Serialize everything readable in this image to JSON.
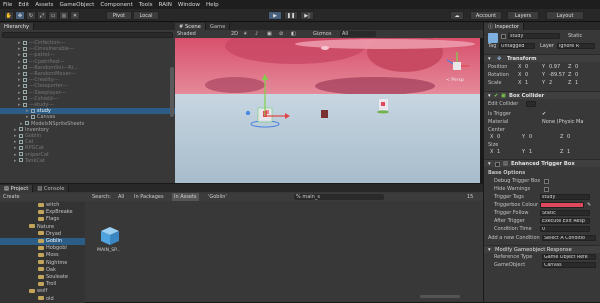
{
  "menubar": [
    "File",
    "Edit",
    "Assets",
    "GameObject",
    "Component",
    "Tools",
    "RAIN",
    "Window",
    "Help"
  ],
  "toolbar": {
    "pivot": "Pivot",
    "local": "Local",
    "account": "Account",
    "layers": "Layers",
    "layout": "Layout"
  },
  "hierarchy": {
    "tab": "Hierarchy",
    "rows": [
      {
        "label": "---Cinfection---",
        "style": "dim"
      },
      {
        "label": "---Cinvulnerable---",
        "style": "dim"
      },
      {
        "label": "---patrol---",
        "style": "dim"
      },
      {
        "label": "---Cpetrified---",
        "style": "dim"
      },
      {
        "label": "---RandomSni---Ri...",
        "style": "dim"
      },
      {
        "label": "---RandomMover---",
        "style": "dim"
      },
      {
        "label": "---Creality---",
        "style": "dim"
      },
      {
        "label": "---Cteleporter---",
        "style": "dim"
      },
      {
        "label": "---Sleeplayer---",
        "style": "dim"
      },
      {
        "label": "---Cshield---",
        "style": "dim"
      },
      {
        "label": "---study---",
        "style": "dim"
      },
      {
        "label": "study",
        "style": "sel"
      },
      {
        "label": "Canvas",
        "style": "norm"
      },
      {
        "label": "ModelsNSpriteSheets",
        "style": "norm"
      },
      {
        "label": "Inventory",
        "style": "norm"
      },
      {
        "label": "Goblin",
        "style": "dim"
      },
      {
        "label": "Cat",
        "style": "dim"
      },
      {
        "label": "RPGCat",
        "style": "dim"
      },
      {
        "label": "sniperCat",
        "style": "dim"
      },
      {
        "label": "TankCat",
        "style": "dim"
      }
    ]
  },
  "scene": {
    "tab_scene": "Scene",
    "tab_game": "Game",
    "shading": "Shaded",
    "mode": "2D",
    "gizmos": "Gizmos",
    "search": "All",
    "persp": "< Persp"
  },
  "inspector": {
    "tab": "Inspector",
    "object_name": "study",
    "static": "Static",
    "tag_label": "Tag",
    "tag": "Untagged",
    "layer_label": "Layer",
    "layer": "Ignore R",
    "transform": {
      "title": "Transform",
      "position": {
        "label": "Position",
        "x": "0",
        "y": "0.97",
        "z": "0"
      },
      "rotation": {
        "label": "Rotation",
        "x": "0",
        "y": "-89.57",
        "z": "0"
      },
      "scale": {
        "label": "Scale",
        "x": "1",
        "y": "2",
        "z": "1"
      }
    },
    "box_collider": {
      "title": "Box Collider",
      "edit_collider": "Edit Collider",
      "is_trigger": "Is Trigger",
      "material_label": "Material",
      "material": "None (Physic Ma",
      "center_label": "Center",
      "center": {
        "x": "0",
        "y": "0",
        "z": "0"
      },
      "size_label": "Size",
      "size": {
        "x": "1",
        "y": "1",
        "z": "1"
      }
    },
    "enhanced": {
      "title": "Enhanced Trigger Box",
      "base_options": "Base Options",
      "debug": "Debug Trigger Box",
      "hide_warnings": "Hide Warnings",
      "tags_label": "Trigger Tags",
      "tags": "study",
      "colour_label": "Triggerbox Colour",
      "follow_label": "Trigger Follow",
      "follow": "Static",
      "after_label": "After Trigger",
      "after": "Execute Exit Resp",
      "cond_time": "Condition Time",
      "cond_time_val": "0",
      "add_cond": "Add a new Condition",
      "add_cond_val": "Select A Conditio"
    },
    "response": {
      "title": "Modify Gameobject Response",
      "ref_type_label": "Reference Type",
      "ref_type": "Game Object Refe",
      "gameobject_label": "GameObject",
      "gameobject": "Canvas"
    }
  },
  "project": {
    "tab_project": "Project",
    "tab_console": "Console",
    "create": "Create",
    "search_all": "All",
    "in_packages": "In Packages",
    "in_assets": "In Assets",
    "goblin": "'Goblin'",
    "path": "% main_s",
    "counter": "15",
    "folders": [
      {
        "label": "witch",
        "indent": 2
      },
      {
        "label": "ExpBreake",
        "indent": 2
      },
      {
        "label": "Flags",
        "indent": 2
      },
      {
        "label": "Nature",
        "indent": 1
      },
      {
        "label": "Dryad",
        "indent": 2
      },
      {
        "label": "Goblin",
        "indent": 2,
        "sel": true
      },
      {
        "label": "Hobgobl",
        "indent": 2
      },
      {
        "label": "Moss",
        "indent": 2
      },
      {
        "label": "Nightme",
        "indent": 2
      },
      {
        "label": "Oak",
        "indent": 2
      },
      {
        "label": "Souleate",
        "indent": 2
      },
      {
        "label": "Troll",
        "indent": 2
      },
      {
        "label": "wolf",
        "indent": 1
      },
      {
        "label": "old",
        "indent": 2
      }
    ],
    "asset_label": "MAIN_SP..."
  }
}
